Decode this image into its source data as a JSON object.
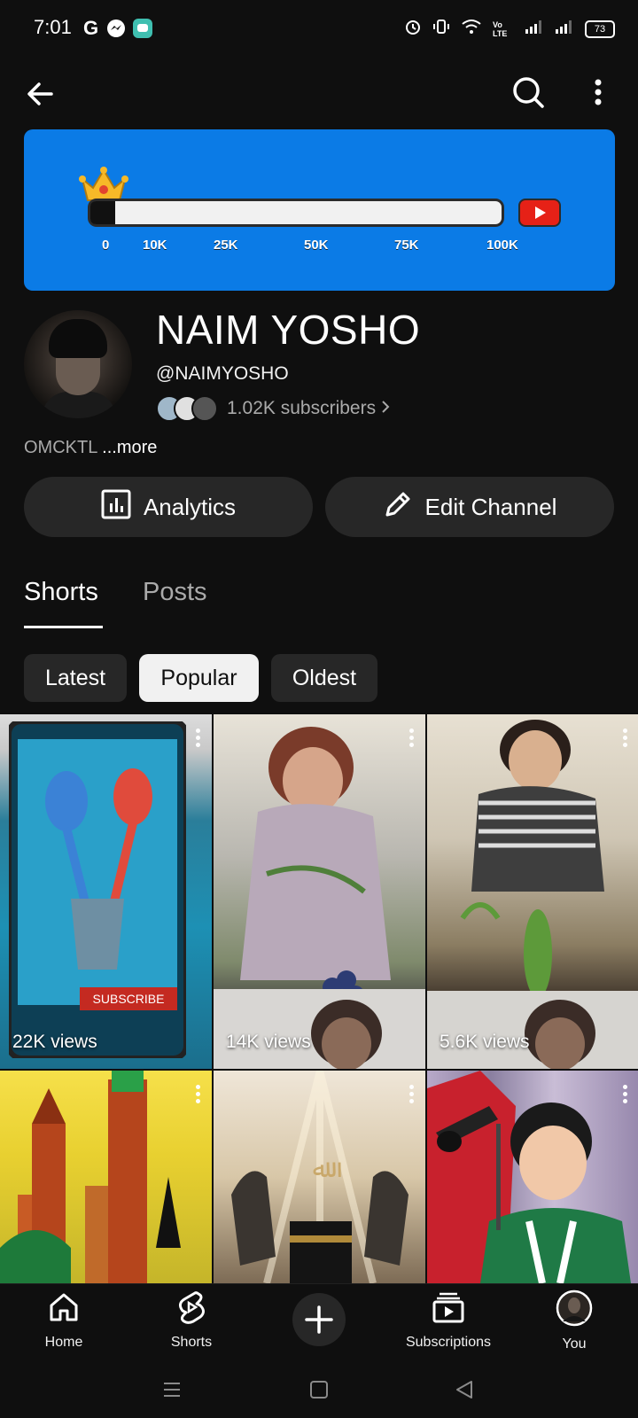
{
  "status_bar": {
    "time": "7:01",
    "battery": "73",
    "network": "Vo LTE"
  },
  "banner": {
    "progress_fraction": 0.06,
    "ticks": [
      "0",
      "10K",
      "25K",
      "50K",
      "75K",
      "100K"
    ]
  },
  "channel": {
    "name": "NAIM YOSHO",
    "handle": "@NAIMYOSHO",
    "subscribers": "1.02K subscribers",
    "description": "OMCKTL",
    "more": "...more"
  },
  "actions": {
    "analytics": "Analytics",
    "edit_channel": "Edit Channel"
  },
  "tabs": [
    {
      "label": "Shorts",
      "selected": true
    },
    {
      "label": "Posts",
      "selected": false
    }
  ],
  "chips": [
    {
      "label": "Latest",
      "selected": false
    },
    {
      "label": "Popular",
      "selected": true
    },
    {
      "label": "Oldest",
      "selected": false
    }
  ],
  "shorts": [
    {
      "views": "22K views"
    },
    {
      "views": "14K views"
    },
    {
      "views": "5.6K views"
    },
    {
      "views": ""
    },
    {
      "views": ""
    },
    {
      "views": ""
    }
  ],
  "bottom_nav": [
    {
      "label": "Home",
      "icon": "home-icon"
    },
    {
      "label": "Shorts",
      "icon": "shorts-icon"
    },
    {
      "label": "",
      "icon": "create-icon"
    },
    {
      "label": "Subscriptions",
      "icon": "subscriptions-icon"
    },
    {
      "label": "You",
      "icon": "you-avatar-icon"
    }
  ],
  "colors": {
    "background": "#0f0f0f",
    "banner": "#0b7be6",
    "button_bg": "#272727",
    "selected_chip": "#f1f1f1",
    "youtube_red": "#e62117"
  }
}
